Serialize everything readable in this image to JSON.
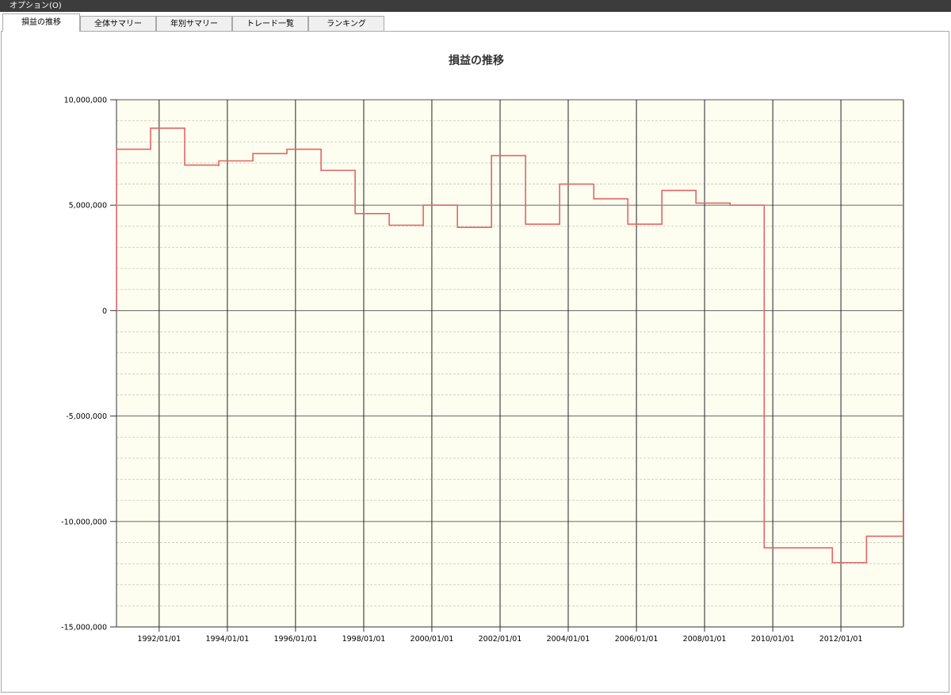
{
  "menu": {
    "options_label": "オプション(O)"
  },
  "tabs": [
    {
      "label": "損益の推移",
      "active": true
    },
    {
      "label": "全体サマリー",
      "active": false
    },
    {
      "label": "年別サマリー",
      "active": false
    },
    {
      "label": "トレード一覧",
      "active": false
    },
    {
      "label": "ランキング",
      "active": false
    }
  ],
  "chart_data": {
    "type": "line",
    "title": "損益の推移",
    "xlabel": "",
    "ylabel": "",
    "ylim": [
      -15000000,
      10000000
    ],
    "xlim": [
      "1990/10/01",
      "2013/11/01"
    ],
    "y_ticks": [
      10000000,
      5000000,
      0,
      -5000000,
      -10000000,
      -15000000
    ],
    "y_tick_labels": [
      "10,000,000",
      "5,000,000",
      "0",
      "-5,000,000",
      "-10,000,000",
      "-15,000,000"
    ],
    "x_ticks": [
      "1992/01/01",
      "1994/01/01",
      "1996/01/01",
      "1998/01/01",
      "2000/01/01",
      "2002/01/01",
      "2004/01/01",
      "2006/01/01",
      "2008/01/01",
      "2010/01/01",
      "2012/01/01"
    ],
    "x_tick_labels": [
      "1992/01/01",
      "1994/01/01",
      "1996/01/01",
      "1998/01/01",
      "2000/01/01",
      "2002/01/01",
      "2004/01/01",
      "2006/01/01",
      "2008/01/01",
      "2010/01/01",
      "2012/01/01"
    ],
    "grid": true,
    "colors": {
      "line": "#e06666",
      "plot_bg": "#fefef0",
      "grid_major": "#555555",
      "grid_minor": "#c8c8b8"
    },
    "series": [
      {
        "step": true,
        "x": [
          "1990/10/01",
          "1990/10/01",
          "1991/10/01",
          "1992/10/01",
          "1993/10/01",
          "1993/10/01",
          "1994/10/01",
          "1994/10/01",
          "1995/10/01",
          "1995/10/01",
          "1996/10/01",
          "1997/10/01",
          "1998/10/01",
          "1998/10/01",
          "1999/10/01",
          "1999/10/01",
          "2000/10/01",
          "2001/10/01",
          "2002/10/01",
          "2003/10/01",
          "2004/10/01",
          "2005/10/01",
          "2006/10/01",
          "2007/10/01",
          "2008/10/01",
          "2009/10/01",
          "2009/10/01",
          "2010/10/01",
          "2011/10/01",
          "2012/10/01",
          "2013/11/01"
        ],
        "y": [
          0,
          7650000,
          8650000,
          6900000,
          6850000,
          7100000,
          7150000,
          7450000,
          7500000,
          7650000,
          6650000,
          4600000,
          4400000,
          4050000,
          4000000,
          5000000,
          3950000,
          7350000,
          4100000,
          6000000,
          5300000,
          4100000,
          5700000,
          5100000,
          5000000,
          -11200000,
          -11250000,
          -11250000,
          -11950000,
          -10700000,
          -9500000
        ]
      }
    ]
  }
}
